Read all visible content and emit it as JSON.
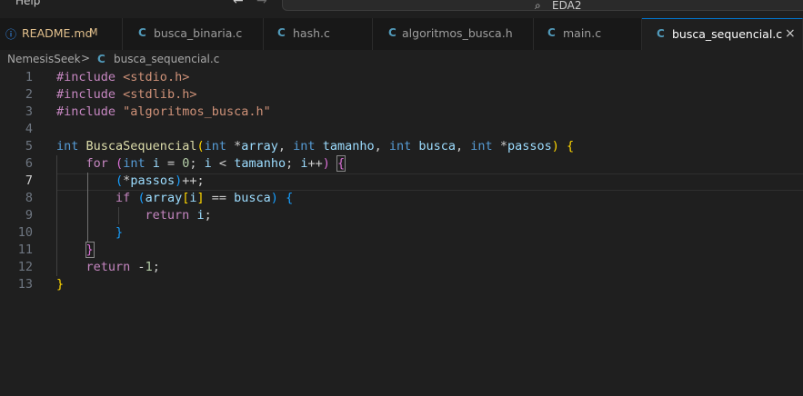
{
  "titlebar": {
    "menu_help": "Help",
    "nav_back": "←",
    "nav_forward": "→",
    "search_icon": "⌕",
    "command_center_text": "EDA2"
  },
  "tabs": [
    {
      "icon": "ⓘ",
      "label": "README.md",
      "modified": "M"
    },
    {
      "icon": "C",
      "label": "busca_binaria.c"
    },
    {
      "icon": "C",
      "label": "hash.c"
    },
    {
      "icon": "C",
      "label": "algoritmos_busca.h"
    },
    {
      "icon": "C",
      "label": "main.c"
    },
    {
      "icon": "C",
      "label": "busca_sequencial.c",
      "active": true,
      "close": "×"
    }
  ],
  "breadcrumb": {
    "root": "NemesisSeek",
    "separator": ">",
    "file_icon": "C",
    "file": "busca_sequencial.c"
  },
  "editor": {
    "current_line": 7,
    "line_numbers": [
      "1",
      "2",
      "3",
      "4",
      "5",
      "6",
      "7",
      "8",
      "9",
      "10",
      "11",
      "12",
      "13"
    ]
  },
  "colors": {
    "accent": "#0078d4",
    "c_file_icon": "#519aba",
    "modified": "#e2c08d"
  }
}
